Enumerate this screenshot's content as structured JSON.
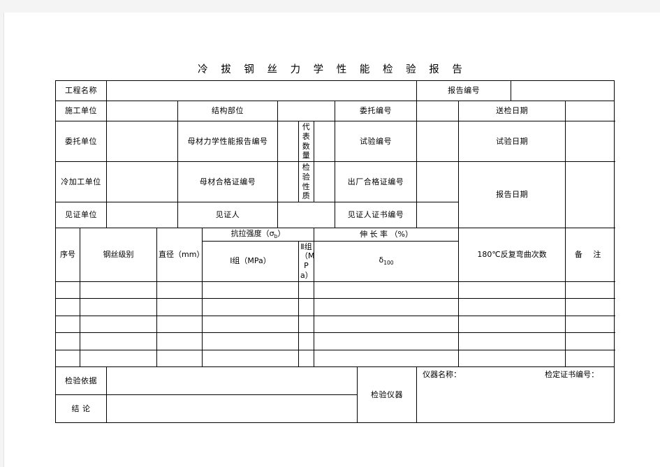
{
  "document": {
    "title": "冷 拔 钢 丝 力 学 性 能 检 验 报 告"
  },
  "info_rows": {
    "project_name_label": "工程名称",
    "report_no_label": "报告编号",
    "construction_unit_label": "施工单位",
    "structure_part_label": "结构部位",
    "entrust_no_label": "委托编号",
    "submit_date_label": "送检日期",
    "entrust_unit_label": "委托单位",
    "base_metal_report_no_label": "母材力学性能报告编号",
    "represent_qty_label": "代表数量",
    "test_no_label": "试验编号",
    "test_date_label": "试验日期",
    "cold_work_unit_label": "冷加工单位",
    "base_metal_cert_no_label": "母材合格证编号",
    "inspect_nature_label": "检验性质",
    "factory_cert_no_label": "出厂合格证编号",
    "report_date_label": "报告日期",
    "witness_unit_label": "见证单位",
    "witness_person_label": "见证人",
    "witness_cert_no_label": "见证人证书编号"
  },
  "data_table": {
    "headers": {
      "seq": "序号",
      "wire_grade": "钢丝级别",
      "diameter": "直径（mm）",
      "tensile_strength": "抗拉强度（σ",
      "tensile_strength_sub": "b",
      "tensile_strength_end": "）",
      "group_1": "Ⅰ组（MPa）",
      "group_2": "Ⅱ组（MPa）",
      "elongation": "伸  长  率  （%）",
      "elongation_symbol": "δ",
      "elongation_sub": "100",
      "bend_count": "180℃反复弯曲次数",
      "remark": "备    注"
    },
    "rows": [
      {
        "seq": "",
        "wire_grade": "",
        "diameter": "",
        "group_1": "",
        "group_2": "",
        "elongation": "",
        "bend_count": "",
        "remark": ""
      },
      {
        "seq": "",
        "wire_grade": "",
        "diameter": "",
        "group_1": "",
        "group_2": "",
        "elongation": "",
        "bend_count": "",
        "remark": ""
      },
      {
        "seq": "",
        "wire_grade": "",
        "diameter": "",
        "group_1": "",
        "group_2": "",
        "elongation": "",
        "bend_count": "",
        "remark": ""
      },
      {
        "seq": "",
        "wire_grade": "",
        "diameter": "",
        "group_1": "",
        "group_2": "",
        "elongation": "",
        "bend_count": "",
        "remark": ""
      },
      {
        "seq": "",
        "wire_grade": "",
        "diameter": "",
        "group_1": "",
        "group_2": "",
        "elongation": "",
        "bend_count": "",
        "remark": ""
      }
    ]
  },
  "footer": {
    "basis_label": "检验依据",
    "conclusion_label": "结    论",
    "instrument_label": "检验仪器",
    "instrument_name_label": "仪器名称：",
    "calibration_cert_label": "检定证书编号："
  }
}
